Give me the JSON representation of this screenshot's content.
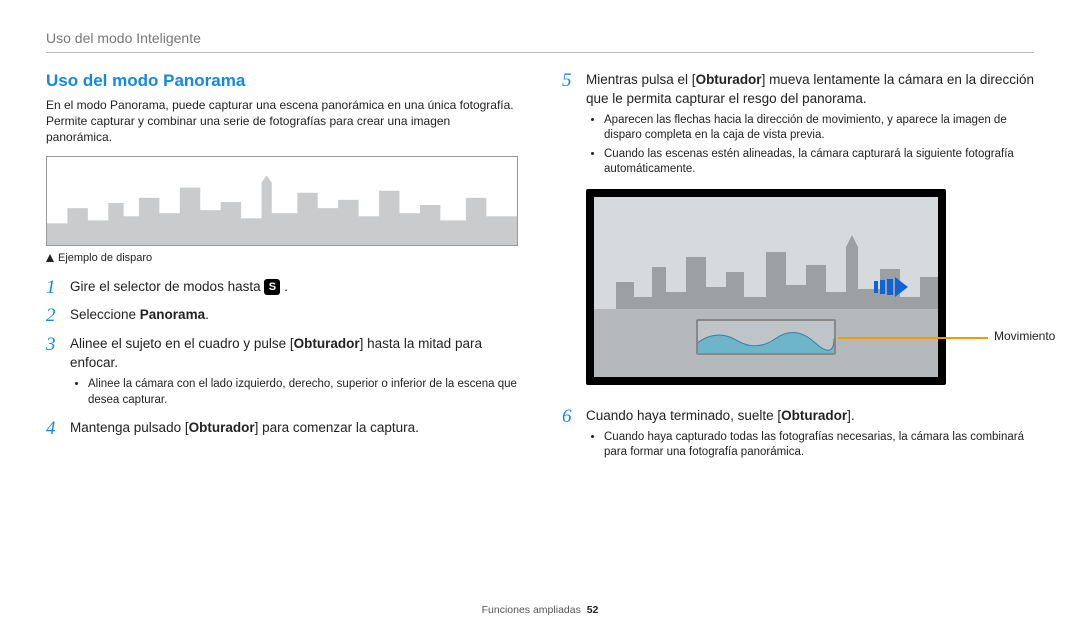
{
  "header": "Uso del modo Inteligente",
  "title": "Uso del modo Panorama",
  "intro": "En el modo Panorama, puede capturar una escena panorámica en una única fotografía. Permite capturar y combinar una serie de fotografías para crear una imagen panorámica.",
  "caption": "Ejemplo de disparo",
  "mode_icon_letter": "S",
  "steps_left": {
    "s1": {
      "n": "1",
      "pre": "Gire el selector de modos hasta ",
      "post": " ."
    },
    "s2": {
      "n": "2",
      "pre": "Seleccione ",
      "bold": "Panorama",
      "post": "."
    },
    "s3": {
      "n": "3",
      "pre": "Alinee el sujeto en el cuadro y pulse [",
      "bold": "Obturador",
      "post": "] hasta la mitad para enfocar.",
      "sub1": "Alinee la cámara con el lado izquierdo, derecho, superior o inferior de la escena que desea capturar."
    },
    "s4": {
      "n": "4",
      "pre": "Mantenga pulsado [",
      "bold": "Obturador",
      "post": "] para comenzar la captura."
    }
  },
  "steps_right": {
    "s5": {
      "n": "5",
      "pre": "Mientras pulsa el [",
      "bold": "Obturador",
      "post": "] mueva lentamente la cámara en la dirección que le permita capturar el resgo del panorama.",
      "sub1": "Aparecen las flechas hacia la dirección de movimiento, y aparece la imagen de disparo completa en la caja de vista previa.",
      "sub2": "Cuando las escenas estén alineadas, la cámara capturará la siguiente fotografía automáticamente."
    },
    "s6": {
      "n": "6",
      "pre": "Cuando haya terminado, suelte [",
      "bold": "Obturador",
      "post": "].",
      "sub1": "Cuando haya capturado todas las fotografías necesarias, la cámara las combinará para formar una fotografía panorámica."
    }
  },
  "movement_label": "Movimiento",
  "footer_text": "Funciones ampliadas",
  "page_number": "52",
  "icons": {
    "mode": "mode-dial-icon",
    "arrow": "direction-arrow-icon"
  }
}
